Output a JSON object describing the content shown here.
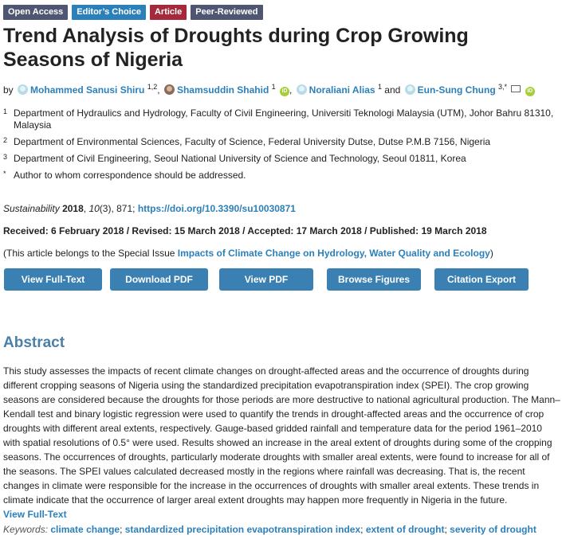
{
  "badges": {
    "open_access": "Open Access",
    "editors_choice": "Editor’s Choice",
    "article": "Article",
    "peer_reviewed": "Peer-Reviewed"
  },
  "title": "Trend Analysis of Droughts during Crop Growing Seasons of Nigeria",
  "authors": {
    "by": "by",
    "list": [
      {
        "name": "Mohammed Sanusi Shiru",
        "sup": "1,2",
        "sep": ","
      },
      {
        "name": "Shamsuddin Shahid",
        "sup": "1",
        "sep": ","
      },
      {
        "name": "Noraliani Alias",
        "sup": "1",
        "sep": "and"
      },
      {
        "name": "Eun-Sung Chung",
        "sup": "3,*",
        "sep": ""
      }
    ],
    "orcid_label": "iD"
  },
  "affiliations": [
    {
      "num": "1",
      "text": "Department of Hydraulics and Hydrology, Faculty of Civil Engineering, Universiti Teknologi Malaysia (UTM), Johor Bahru 81310, Malaysia"
    },
    {
      "num": "2",
      "text": "Department of Environmental Sciences, Faculty of Science, Federal University Dutse, Dutse P.M.B 7156, Nigeria"
    },
    {
      "num": "3",
      "text": "Department of Civil Engineering, Seoul National University of Science and Technology, Seoul 01811, Korea"
    },
    {
      "num": "*",
      "text": "Author to whom correspondence should be addressed."
    }
  ],
  "citation": {
    "journal": "Sustainability",
    "year": "2018",
    "volume": "10",
    "issue": "(3), 871;",
    "doi": "https://doi.org/10.3390/su10030871"
  },
  "dates": "Received: 6 February 2018 / Revised: 15 March 2018 / Accepted: 17 March 2018 / Published: 19 March 2018",
  "special_issue": {
    "prefix": "(This article belongs to the Special Issue",
    "link": "Impacts of Climate Change on Hydrology, Water Quality and Ecology",
    "suffix": ")"
  },
  "buttons": {
    "view_full_text": "View Full-Text",
    "download_pdf": "Download PDF",
    "view_pdf": "View PDF",
    "browse_figures": "Browse Figures",
    "citation_export": "Citation Export"
  },
  "abstract": {
    "heading": "Abstract",
    "text": "This study assesses the impacts of recent climate changes on drought-affected areas and the occurrence of droughts during different cropping seasons of Nigeria using the standardized precipitation evapotranspiration index (SPEI). The crop growing seasons are considered because the droughts for those periods are more destructive to national agricultural production. The Mann–Kendall test and binary logistic regression were used to quantify the trends in drought-affected areas and the occurrence of crop droughts with different areal extents, respectively. Gauge-based gridded rainfall and temperature data for the period 1961–2010 with spatial resolutions of 0.5° were used. Results showed an increase in the areal extent of droughts during some of the cropping seasons. The occurrences of droughts, particularly moderate droughts with smaller areal extents, were found to increase for all of the seasons. The SPEI values calculated decreased mostly in the regions where rainfall was decreasing. That is, the recent changes in climate were responsible for the increase in the occurrences of droughts with smaller areal extents. These trends in climate indicate that the occurrence of larger areal extent droughts may happen more frequently in Nigeria in the future.",
    "more_link": "View Full-Text"
  },
  "keywords": {
    "label": "Keywords:",
    "items": [
      "climate change",
      "standardized precipitation evapotranspiration index",
      "extent of drought",
      "severity of drought"
    ]
  },
  "colors": {
    "link": "#2c80b9",
    "button": "#3a80b3",
    "heading": "#4a7fa8",
    "badge_article": "#a3293b",
    "badge_editor": "#2c80b9",
    "badge_gray": "#4f5671",
    "orcid": "#a6ce39"
  }
}
